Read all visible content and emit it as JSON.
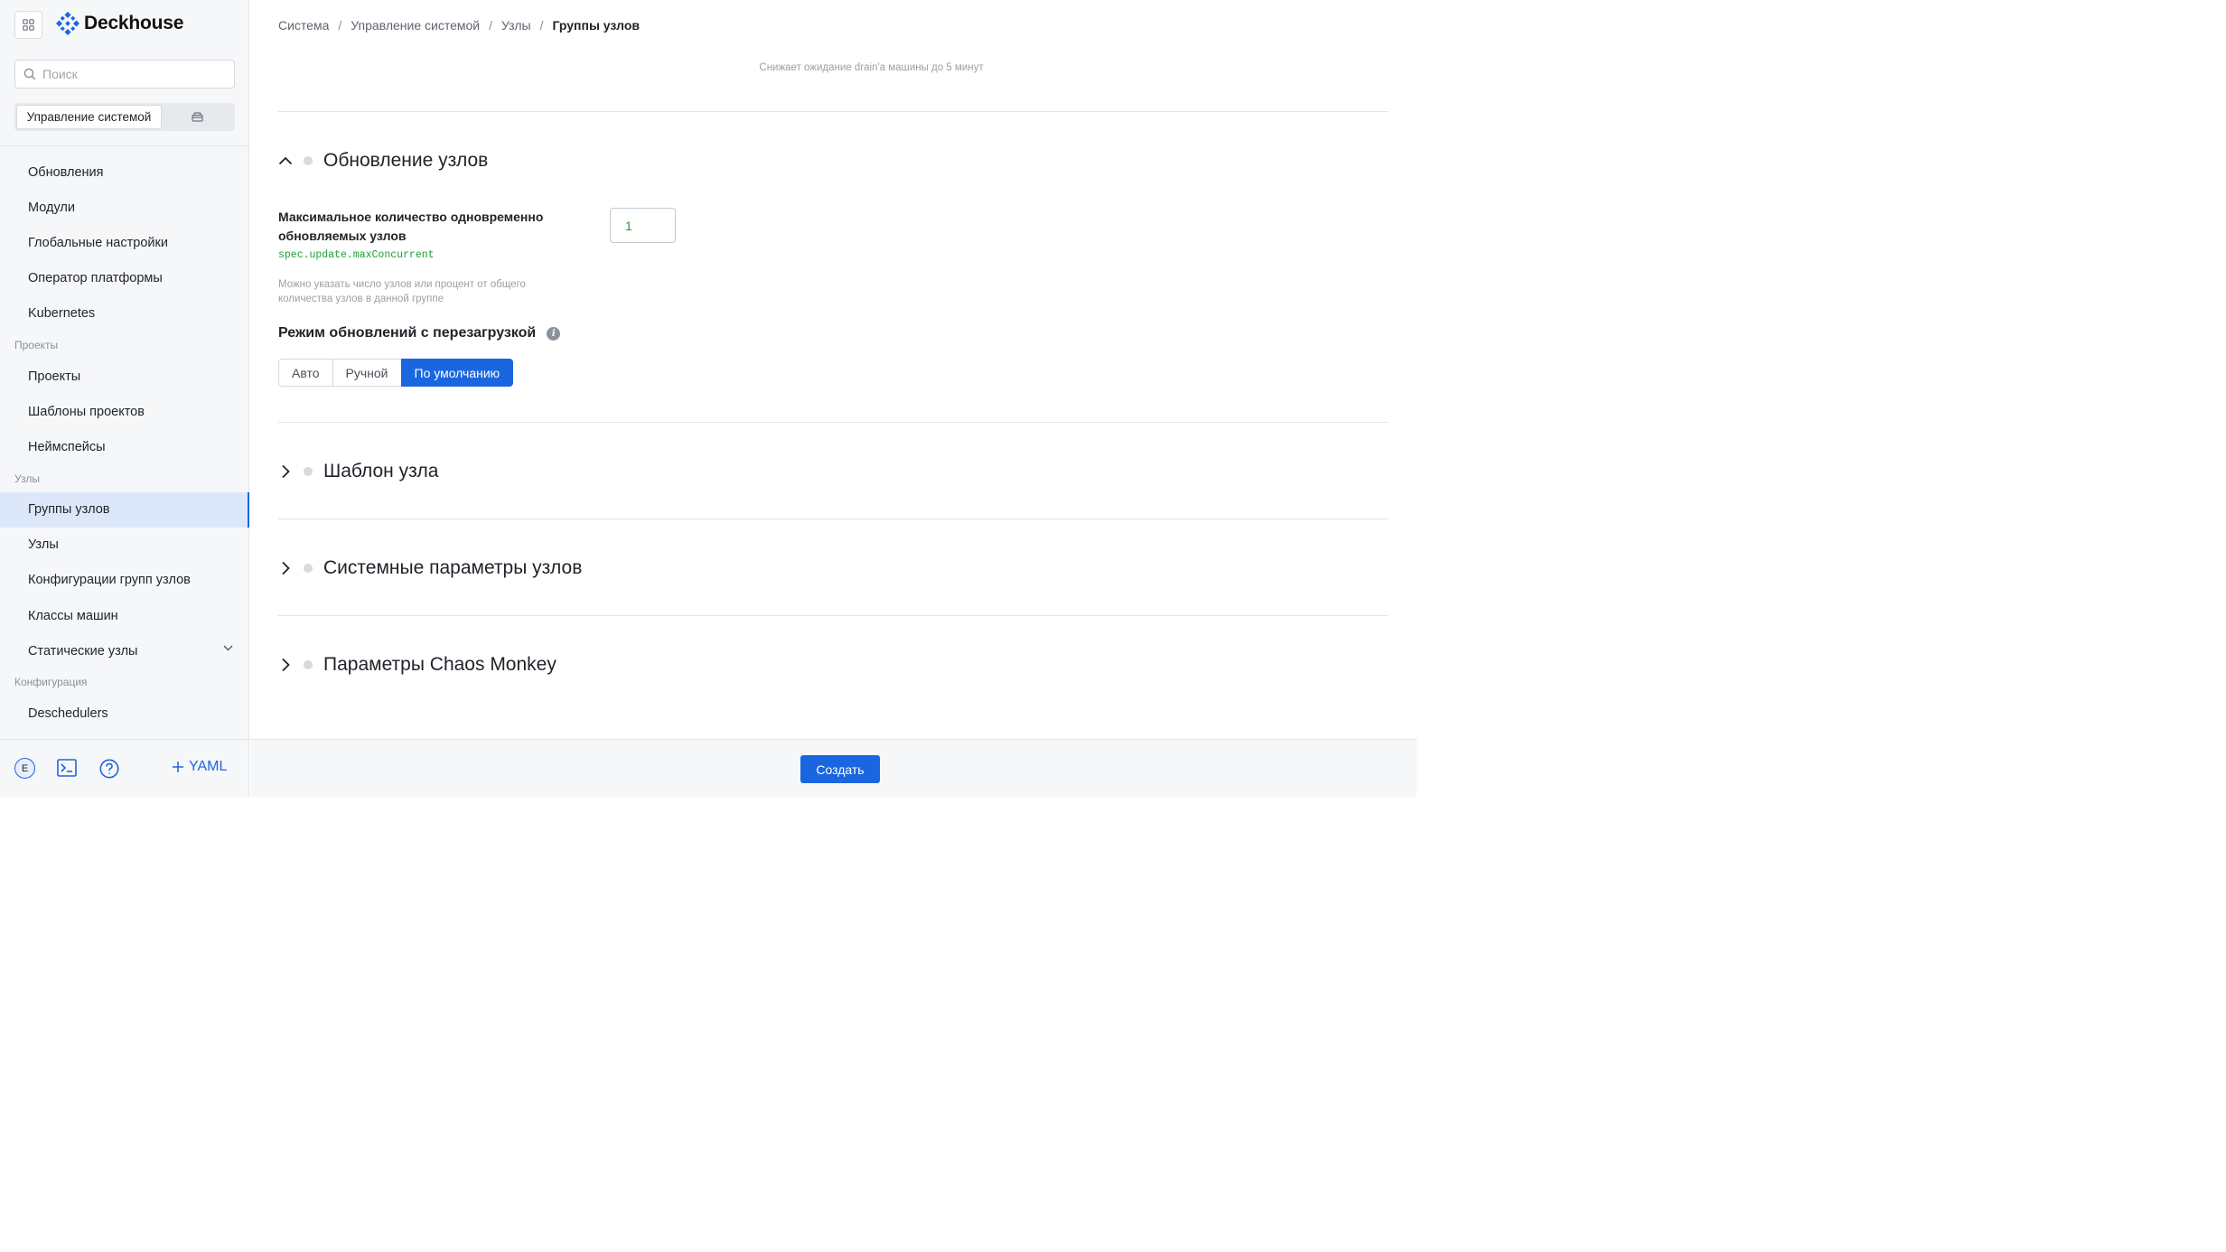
{
  "app": {
    "name": "Deckhouse"
  },
  "search": {
    "placeholder": "Поиск",
    "value": ""
  },
  "segment": {
    "active_label": "Управление системой",
    "other_icon": "box-icon"
  },
  "sidebar": {
    "groups": [
      {
        "items": [
          "Обновления",
          "Модули",
          "Глобальные настройки",
          "Оператор платформы",
          "Kubernetes"
        ]
      },
      {
        "section": "Проекты",
        "items": [
          "Проекты",
          "Шаблоны проектов",
          "Неймспейсы"
        ]
      },
      {
        "section": "Узлы",
        "items": [
          "Группы узлов",
          "Узлы",
          "Конфигурации групп узлов",
          "Классы машин",
          "Статические узлы"
        ]
      },
      {
        "section": "Конфигурация",
        "items": [
          "Deschedulers"
        ]
      }
    ],
    "active_item": "Группы узлов",
    "avatar_letter": "E",
    "yaml_label": "YAML"
  },
  "breadcrumb": [
    "Система",
    "Управление системой",
    "Узлы",
    "Группы узлов"
  ],
  "main": {
    "top_note": "Снижает ожидание drain'a машины до 5 минут",
    "update_section": {
      "title": "Обновление узлов",
      "max_concurrent_label": "Максимальное количество одновременно обновляемых узлов",
      "max_concurrent_path": "spec.update.maxConcurrent",
      "max_concurrent_hint": "Можно указать число узлов или процент от общего количества узлов в данной группе",
      "max_concurrent_value": "1",
      "reboot_label": "Режим обновлений с перезагрузкой",
      "reboot_options": [
        "Авто",
        "Ручной",
        "По умолчанию"
      ],
      "reboot_selected": "По умолчанию"
    },
    "collapsed_sections": [
      "Шаблон узла",
      "Системные параметры узлов",
      "Параметры Chaos Monkey"
    ]
  },
  "footer": {
    "create_label": "Создать"
  },
  "colors": {
    "accent": "#1a66e0",
    "active_bg": "#dce8fa",
    "code_green": "#1f9d3a"
  }
}
